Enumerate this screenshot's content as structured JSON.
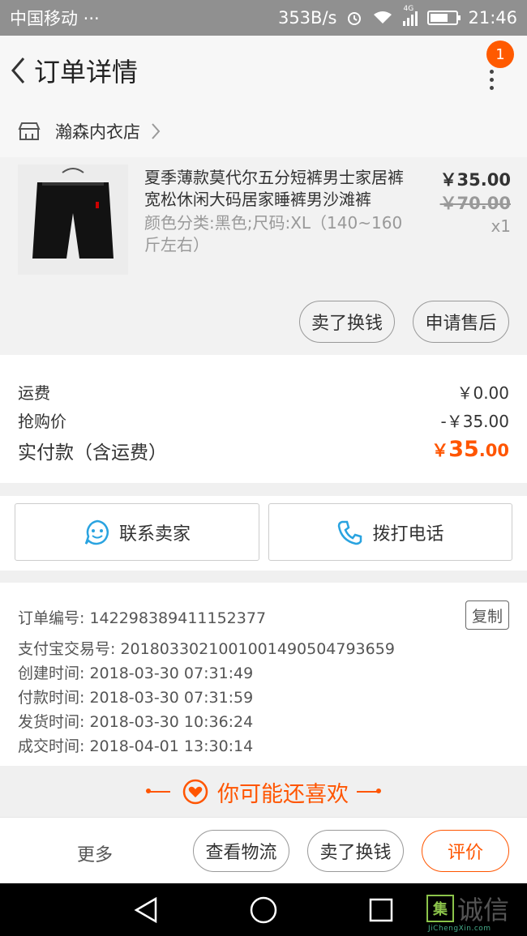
{
  "status_bar": {
    "carrier": "中国移动 ···",
    "net_speed": "353B/s",
    "network": "4G",
    "time": "21:46"
  },
  "header": {
    "title": "订单详情",
    "badge_count": "1"
  },
  "shop": {
    "name": "瀚森内衣店"
  },
  "product": {
    "title": "夏季薄款莫代尔五分短裤男士家居裤宽松休闲大码居家睡裤男沙滩裤",
    "spec": "颜色分类:黑色;尺码:XL（140~160斤左右）",
    "price": "￥35.00",
    "original_price": "￥70.00",
    "quantity": "x1",
    "buttons": {
      "sell": "卖了换钱",
      "after_sale": "申请售后"
    }
  },
  "fees": {
    "shipping_label": "运费",
    "shipping_value": "￥0.00",
    "flash_label": "抢购价",
    "flash_value": "-￥35.00",
    "total_label": "实付款（含运费）",
    "total_currency": "￥",
    "total_int": "35",
    "total_dec": ".00"
  },
  "contact": {
    "seller": "联系卖家",
    "phone": "拨打电话"
  },
  "order_info": {
    "order_no": "订单编号: 142298389411152377",
    "alipay_no": "支付宝交易号: 2018033021001001490504793659",
    "created": "创建时间: 2018-03-30 07:31:49",
    "paid": "付款时间: 2018-03-30 07:31:59",
    "shipped": "发货时间: 2018-03-30 10:36:24",
    "completed": "成交时间: 2018-04-01 13:30:14",
    "copy": "复制"
  },
  "recommend": {
    "title": "你可能还喜欢"
  },
  "bottom_bar": {
    "more": "更多",
    "track": "查看物流",
    "sell": "卖了换钱",
    "review": "评价"
  },
  "watermark": {
    "box": "集",
    "text": "诚信",
    "sub": "JiChengXin.com"
  },
  "colors": {
    "accent": "#ff5500",
    "badge": "#ff5a00",
    "status_bar": "#909090",
    "contact_icon": "#29a3e0"
  },
  "icons": [
    "back-arrow-icon",
    "more-vertical-icon",
    "shop-icon",
    "chevron-right-icon",
    "chat-smile-icon",
    "phone-icon",
    "heart-icon",
    "nav-back-icon",
    "nav-home-icon",
    "nav-recent-icon"
  ]
}
